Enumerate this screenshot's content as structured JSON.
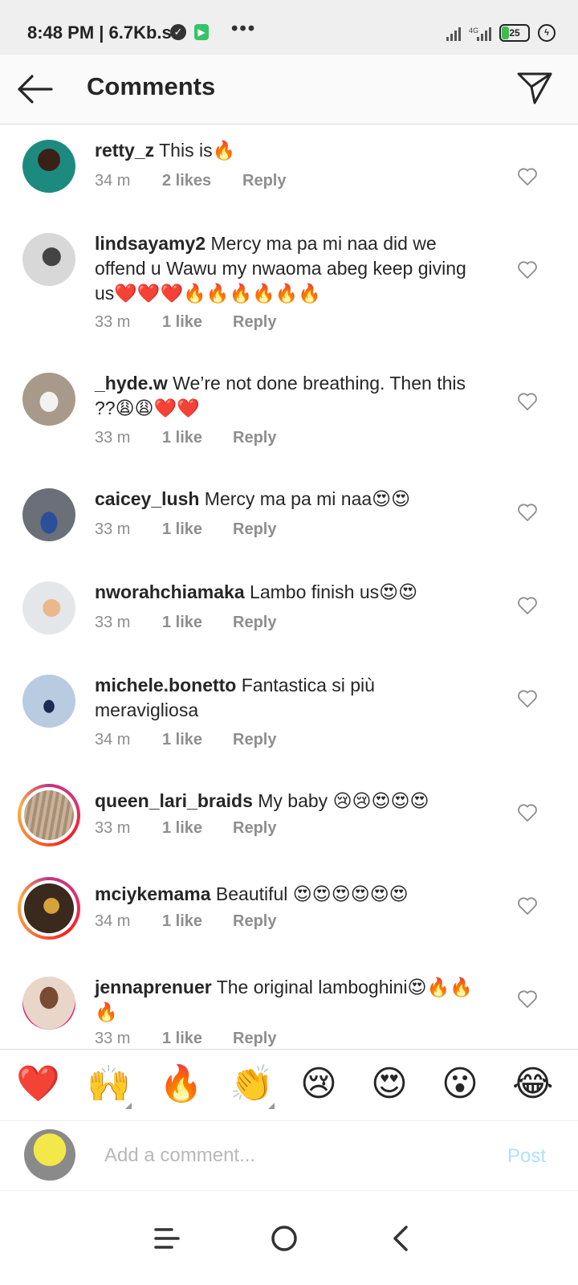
{
  "status": {
    "time": "8:48 PM | 6.7Kb.s",
    "more": "•••",
    "network": "4G",
    "battery": "25"
  },
  "header": {
    "title": "Comments"
  },
  "comments": [
    {
      "user": "retty_z",
      "text": " This is🔥",
      "time": "34 m",
      "likes": "2 likes",
      "reply": "Reply"
    },
    {
      "user": "lindsayamy2",
      "text": " Mercy ma pa mi naa did we offend u Wawu my nwaoma abeg keep giving us❤️❤️❤️🔥🔥🔥🔥🔥🔥",
      "time": "33 m",
      "likes": "1 like",
      "reply": "Reply"
    },
    {
      "user": "_hyde.w",
      "text": " We’re not done breathing. Then this ??😩😩❤️❤️",
      "time": "33 m",
      "likes": "1 like",
      "reply": "Reply"
    },
    {
      "user": "caicey_lush",
      "text": " Mercy ma pa mi naa😍😍",
      "time": "33 m",
      "likes": "1 like",
      "reply": "Reply"
    },
    {
      "user": "nworahchiamaka",
      "text": " Lambo finish us😍😍",
      "time": "33 m",
      "likes": "1 like",
      "reply": "Reply"
    },
    {
      "user": "michele.bonetto",
      "text": " Fantastica  si  più meravigliosa",
      "time": "34 m",
      "likes": "1 like",
      "reply": "Reply"
    },
    {
      "user": "queen_lari_braids",
      "text": " My baby 😢😢😍😍😍",
      "time": "33 m",
      "likes": "1 like",
      "reply": "Reply"
    },
    {
      "user": "mciykemama",
      "text": " Beautiful 😍😍😍😍😍😍",
      "time": "34 m",
      "likes": "1 like",
      "reply": "Reply"
    },
    {
      "user": "jennaprenuer",
      "text": " The original lamboghini😍🔥🔥🔥",
      "time": "33 m",
      "likes": "1 like",
      "reply": "Reply"
    }
  ],
  "reactions": [
    "❤️",
    "🙌",
    "🔥",
    "👏",
    "😢",
    "😍",
    "😮",
    "😂"
  ],
  "composer": {
    "placeholder": "Add a comment...",
    "post_label": "Post"
  },
  "colors": {
    "post_disabled": "#b2dffc",
    "meta_gray": "#8e8e8e",
    "story_ring": "#e1306c"
  }
}
